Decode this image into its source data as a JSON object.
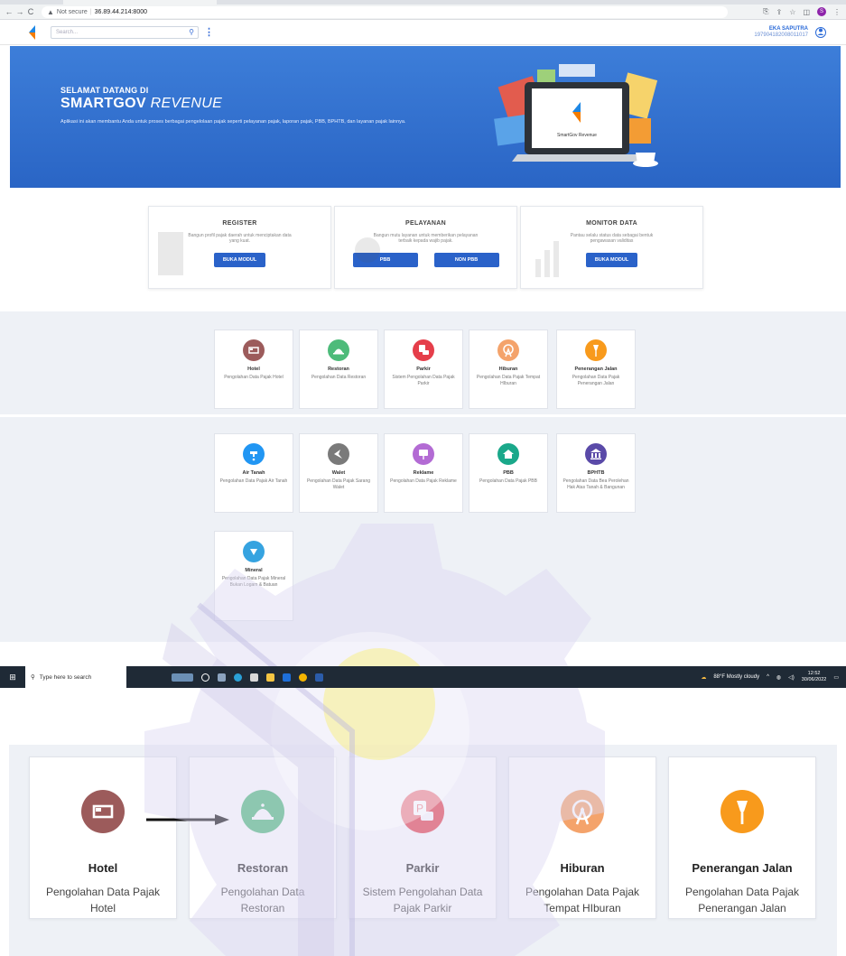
{
  "browser": {
    "security_label": "Not secure",
    "url": "36.89.44.214:8000",
    "back_icon": "arrow-left-icon",
    "forward_icon": "arrow-right-icon",
    "reload_icon": "reload-icon",
    "profile_initial": "S"
  },
  "header": {
    "search_placeholder": "Search...",
    "user_name": "EKA SAPUTRA",
    "user_nip": "197904182008011017"
  },
  "hero": {
    "welcome": "SELAMAT DATANG DI",
    "brand_main": "SMARTGOV",
    "brand_sub": "REVENUE",
    "description": "Aplikasi ini akan membantu Anda untuk proses berbagai pengelolaan pajak seperti pelayanan pajak, laporan pajak, PBB, BPHTB, dan layanan pajak lainnya.",
    "screen_logo_text": "SmartGov Revenue"
  },
  "modules": [
    {
      "title": "REGISTER",
      "subtitle": "Bangun profil pajak daerah untuk menciptakan data yang kuat.",
      "buttons": [
        "BUKA MODUL"
      ]
    },
    {
      "title": "PELAYANAN",
      "subtitle": "Bangun mutu layanan untuk memberikan pelayanan terbaik kepada wajib pajak.",
      "buttons": [
        "PBB",
        "NON PBB"
      ]
    },
    {
      "title": "MONITOR DATA",
      "subtitle": "Pantau selalu status data sebagai bentuk pengawasan validitas",
      "buttons": [
        "BUKA MODUL"
      ]
    }
  ],
  "tiles_row1": [
    {
      "name": "Hotel",
      "desc": "Pengolahan Data Pajak Hotel",
      "color": "#9c5b5b",
      "icon": "bed-icon"
    },
    {
      "name": "Restoran",
      "desc": "Pengolahan Data Restoran",
      "color": "#4dbb7a",
      "icon": "service-bell-icon"
    },
    {
      "name": "Parkir",
      "desc": "Sistem Pengolahan Data Pajak Parkir",
      "color": "#e53e4a",
      "icon": "parking-icon"
    },
    {
      "name": "Hiburan",
      "desc": "Pengolahan Data Pajak Tempat HIburan",
      "color": "#f4a36b",
      "icon": "ferris-wheel-icon"
    },
    {
      "name": "Penerangan Jalan",
      "desc": "Pengolahan Data Pajak Penerangan Jalan",
      "color": "#f89a1c",
      "icon": "street-lamp-icon"
    }
  ],
  "tiles_row2": [
    {
      "name": "Air Tanah",
      "desc": "Pengolahan Data Pajak Air Tanah",
      "color": "#2196f3",
      "icon": "water-tap-icon"
    },
    {
      "name": "Walet",
      "desc": "Pengolahan Data Pajak Sarang Walet",
      "color": "#7a7a7a",
      "icon": "bird-icon"
    },
    {
      "name": "Reklame",
      "desc": "Pengolahan Data Pajak Reklame",
      "color": "#b36bd4",
      "icon": "billboard-icon"
    },
    {
      "name": "PBB",
      "desc": "Pengolahan Data Pajak PBB",
      "color": "#1aa88a",
      "icon": "house-icon"
    },
    {
      "name": "BPHTB",
      "desc": "Pengolahan Data Bea Perolehan Hak Atas Tanah & Bangunan",
      "color": "#5a4aa8",
      "icon": "bank-icon"
    },
    {
      "name": "Mineral",
      "desc": "Pengolahan Data Pajak Mineral Bukan Logam & Batuan",
      "color": "#36a3e0",
      "icon": "mineral-icon"
    }
  ],
  "taskbar": {
    "search_placeholder": "Type here to search",
    "weather": "88°F  Mostly cloudy",
    "time": "12:52",
    "date": "30/06/2022"
  },
  "zoom_tiles": [
    {
      "name": "Hotel",
      "desc": "Pengolahan Data Pajak Hotel",
      "color": "#9c5b5b",
      "icon": "bed-icon"
    },
    {
      "name": "Restoran",
      "desc": "Pengolahan Data Restoran",
      "color": "#4dbb7a",
      "icon": "service-bell-icon"
    },
    {
      "name": "Parkir",
      "desc": "Sistem Pengolahan Data Pajak Parkir",
      "color": "#e53e4a",
      "icon": "parking-icon"
    },
    {
      "name": "Hiburan",
      "desc": "Pengolahan Data Pajak Tempat HIburan",
      "color": "#f4a36b",
      "icon": "ferris-wheel-icon"
    },
    {
      "name": "Penerangan Jalan",
      "desc": "Pengolahan Data Pajak Penerangan Jalan",
      "color": "#f89a1c",
      "icon": "street-lamp-icon"
    }
  ]
}
